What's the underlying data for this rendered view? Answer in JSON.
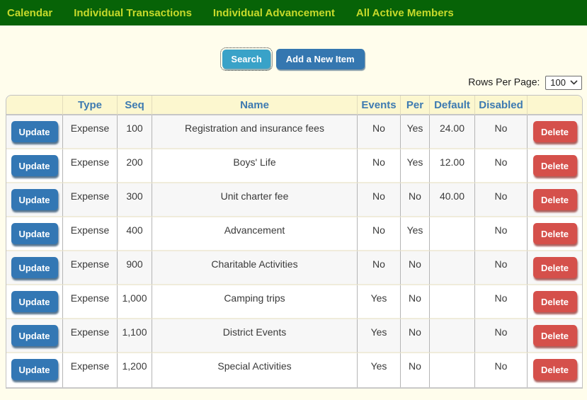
{
  "nav": {
    "items": [
      {
        "label": "Calendar"
      },
      {
        "label": "Individual Transactions"
      },
      {
        "label": "Individual Advancement"
      },
      {
        "label": "All Active Members"
      }
    ]
  },
  "toolbar": {
    "search_label": "Search",
    "add_label": "Add a New Item"
  },
  "pagination": {
    "rows_per_page_label": "Rows Per Page:",
    "selected_value": "100",
    "options_visible": [
      "100"
    ]
  },
  "table": {
    "columns": [
      "",
      "Type",
      "Seq",
      "Name",
      "Events",
      "Per",
      "Default",
      "Disabled",
      ""
    ],
    "update_label": "Update",
    "delete_label": "Delete",
    "rows": [
      {
        "type": "Expense",
        "seq": "100",
        "name": "Registration and insurance fees",
        "events": "No",
        "per": "Yes",
        "default": "24.00",
        "disabled": "No"
      },
      {
        "type": "Expense",
        "seq": "200",
        "name": "Boys' Life",
        "events": "No",
        "per": "Yes",
        "default": "12.00",
        "disabled": "No"
      },
      {
        "type": "Expense",
        "seq": "300",
        "name": "Unit charter fee",
        "events": "No",
        "per": "No",
        "default": "40.00",
        "disabled": "No"
      },
      {
        "type": "Expense",
        "seq": "400",
        "name": "Advancement",
        "events": "No",
        "per": "Yes",
        "default": "",
        "disabled": "No"
      },
      {
        "type": "Expense",
        "seq": "900",
        "name": "Charitable Activities",
        "events": "No",
        "per": "No",
        "default": "",
        "disabled": "No"
      },
      {
        "type": "Expense",
        "seq": "1,000",
        "name": "Camping trips",
        "events": "Yes",
        "per": "No",
        "default": "",
        "disabled": "No"
      },
      {
        "type": "Expense",
        "seq": "1,100",
        "name": "District Events",
        "events": "Yes",
        "per": "No",
        "default": "",
        "disabled": "No"
      },
      {
        "type": "Expense",
        "seq": "1,200",
        "name": "Special Activities",
        "events": "Yes",
        "per": "No",
        "default": "",
        "disabled": "No"
      }
    ]
  },
  "colors": {
    "nav_background": "#076307",
    "nav_text": "#c6da2b",
    "page_background": "#fffdec",
    "header_background": "#fcf7cf",
    "header_text": "#3d7ab1",
    "search_button": "#39a2c8",
    "add_button": "#3577b0",
    "update_button": "#3377b4",
    "delete_button": "#d5504b",
    "odd_row": "#f7f7f7",
    "even_row": "#ffffff"
  }
}
